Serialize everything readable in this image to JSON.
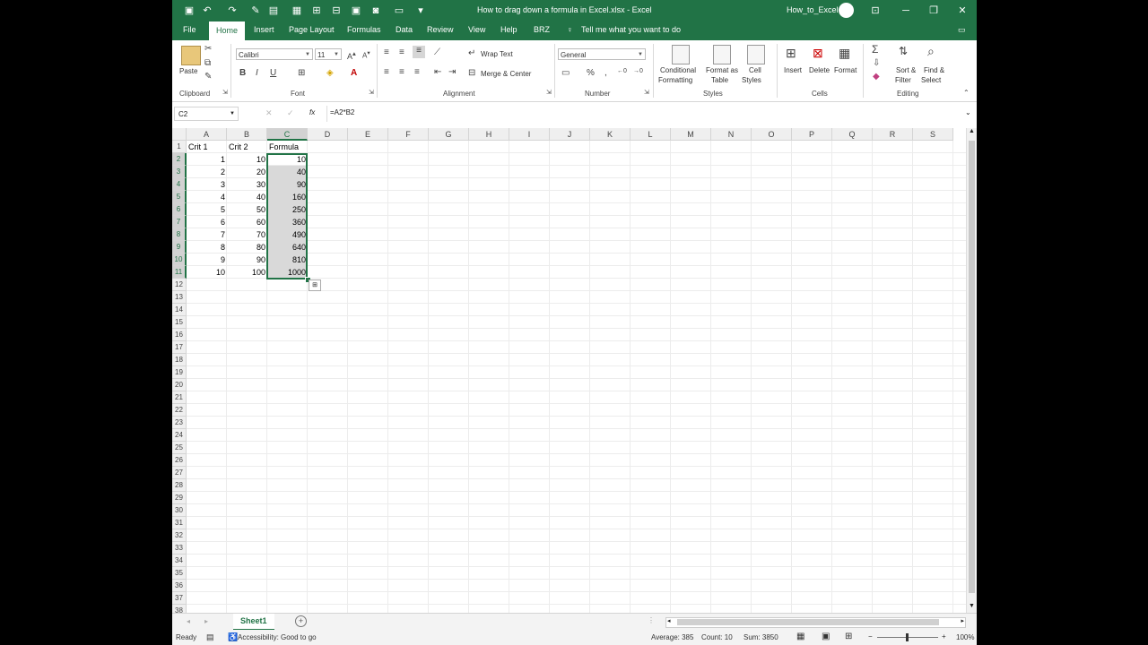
{
  "window": {
    "title": "How to drag down a formula in Excel.xlsx - Excel",
    "user": "How_to_Excel"
  },
  "tabs": [
    {
      "label": "File"
    },
    {
      "label": "Home"
    },
    {
      "label": "Insert"
    },
    {
      "label": "Page Layout"
    },
    {
      "label": "Formulas"
    },
    {
      "label": "Data"
    },
    {
      "label": "Review"
    },
    {
      "label": "View"
    },
    {
      "label": "Help"
    },
    {
      "label": "BRZ"
    }
  ],
  "tell_me": "Tell me what you want to do",
  "ribbon": {
    "clipboard": {
      "paste": "Paste",
      "label": "Clipboard"
    },
    "font": {
      "name": "Calibri",
      "size": "11",
      "bold": "B",
      "italic": "I",
      "underline": "U",
      "label": "Font"
    },
    "alignment": {
      "wrap": "Wrap Text",
      "merge": "Merge & Center",
      "label": "Alignment"
    },
    "number": {
      "format": "General",
      "percent": "%",
      "comma": ",",
      "label": "Number"
    },
    "styles": {
      "cond1": "Conditional",
      "cond2": "Formatting",
      "table1": "Format as",
      "table2": "Table",
      "cell1": "Cell",
      "cell2": "Styles",
      "label": "Styles"
    },
    "cells": {
      "insert": "Insert",
      "delete": "Delete",
      "format": "Format",
      "label": "Cells"
    },
    "editing": {
      "sort1": "Sort &",
      "sort2": "Filter",
      "find1": "Find &",
      "find2": "Select",
      "label": "Editing"
    }
  },
  "formula_bar": {
    "name_box": "C2",
    "fx": "fx",
    "formula": "=A2*B2"
  },
  "columns": [
    "A",
    "B",
    "C",
    "D",
    "E",
    "F",
    "G",
    "H",
    "I",
    "J",
    "K",
    "L",
    "M",
    "N",
    "O",
    "P",
    "Q",
    "R",
    "S"
  ],
  "selected_column": "C",
  "header_row": [
    "Crit 1",
    "Crit 2",
    "Formula"
  ],
  "data_rows": [
    [
      "1",
      "10",
      "10"
    ],
    [
      "2",
      "20",
      "40"
    ],
    [
      "3",
      "30",
      "90"
    ],
    [
      "4",
      "40",
      "160"
    ],
    [
      "5",
      "50",
      "250"
    ],
    [
      "6",
      "60",
      "360"
    ],
    [
      "7",
      "70",
      "490"
    ],
    [
      "8",
      "80",
      "640"
    ],
    [
      "9",
      "90",
      "810"
    ],
    [
      "10",
      "100",
      "1000"
    ]
  ],
  "row_count": 38,
  "sheet_tab": "Sheet1",
  "status": {
    "ready": "Ready",
    "accessibility": "Accessibility: Good to go",
    "average": "Average: 385",
    "count": "Count: 10",
    "sum": "Sum: 3850",
    "zoom": "100%"
  }
}
